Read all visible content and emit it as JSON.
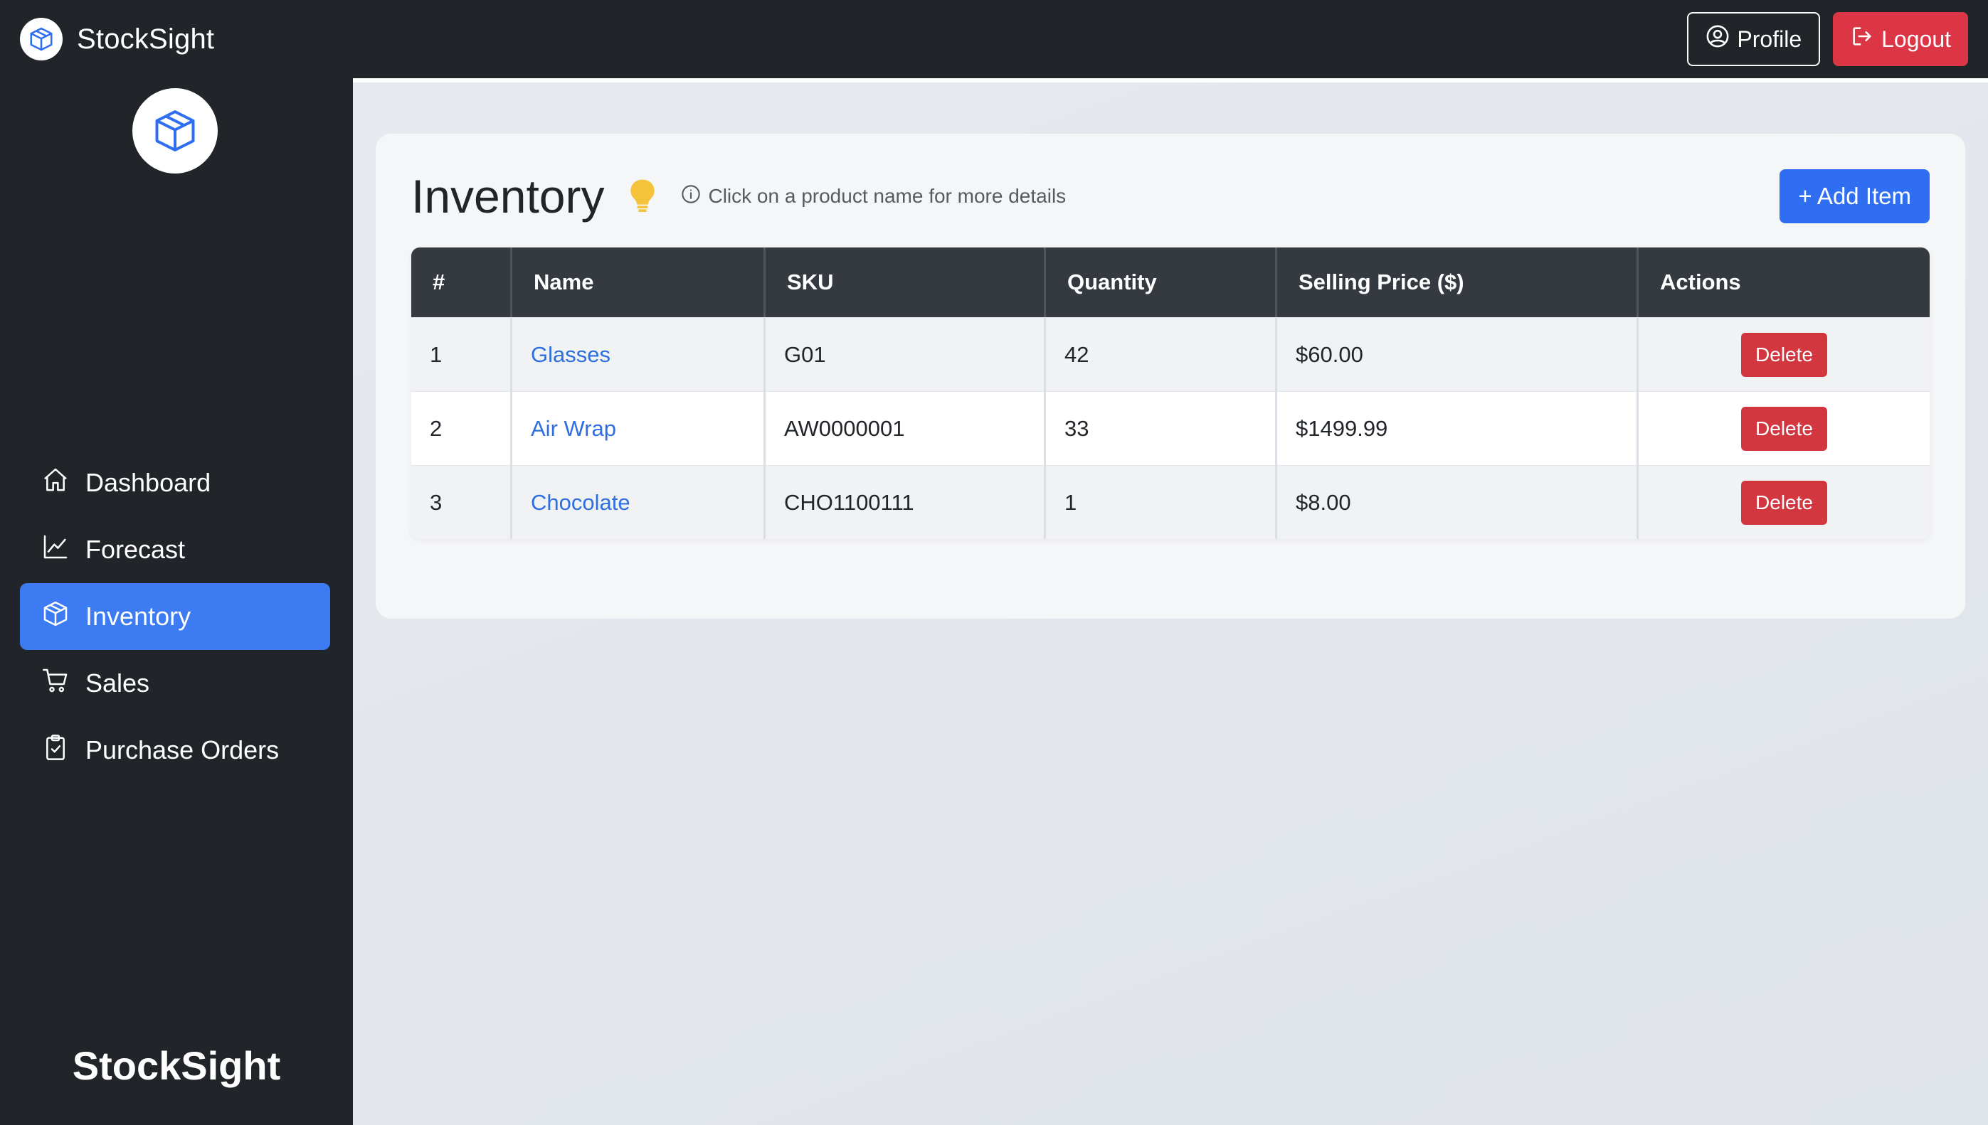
{
  "app": {
    "brand": "StockSight",
    "footer_brand": "StockSight"
  },
  "navbar": {
    "profile_label": "Profile",
    "logout_label": "Logout"
  },
  "sidebar": {
    "items": [
      {
        "label": "Dashboard",
        "icon": "home-icon",
        "active": false
      },
      {
        "label": "Forecast",
        "icon": "chart-line-icon",
        "active": false
      },
      {
        "label": "Inventory",
        "icon": "box-icon",
        "active": true
      },
      {
        "label": "Sales",
        "icon": "cart-icon",
        "active": false
      },
      {
        "label": "Purchase Orders",
        "icon": "clipboard-check-icon",
        "active": false
      }
    ]
  },
  "main": {
    "title": "Inventory",
    "hint": "Click on a product name for more details",
    "add_label": "+ Add Item",
    "table": {
      "headers": [
        "#",
        "Name",
        "SKU",
        "Quantity",
        "Selling Price ($)",
        "Actions"
      ],
      "rows": [
        {
          "index": "1",
          "name": "Glasses",
          "sku": "G01",
          "quantity": "42",
          "price": "$60.00",
          "action": "Delete"
        },
        {
          "index": "2",
          "name": "Air Wrap",
          "sku": "AW0000001",
          "quantity": "33",
          "price": "$1499.99",
          "action": "Delete"
        },
        {
          "index": "3",
          "name": "Chocolate",
          "sku": "CHO1100111",
          "quantity": "1",
          "price": "$8.00",
          "action": "Delete"
        }
      ]
    }
  },
  "colors": {
    "navbar_bg": "#212529",
    "accent": "#2f6ef0",
    "danger": "#dc3545",
    "link": "#2e6fe0",
    "bulb": "#f5c23c"
  }
}
